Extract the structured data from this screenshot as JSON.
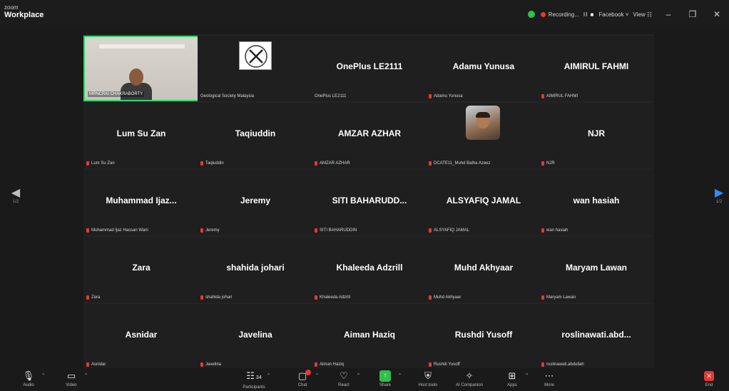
{
  "window": {
    "brand_top": "zoom",
    "brand_bottom": "Workplace",
    "recording": "Recording...",
    "recording_controls": "II ■",
    "live": "Facebook ˅",
    "view": "View ☷",
    "minimize": "–",
    "restore": "❐",
    "close": "✕"
  },
  "nav": {
    "prev": "◀",
    "next": "▶",
    "page_left": "1/2",
    "page_right": "1/2"
  },
  "tiles": [
    {
      "name": "",
      "label": "MRNCRAI CHAKRABORTY"
    },
    {
      "name": "",
      "label": "Geological Society Malaysia"
    },
    {
      "name": "OnePlus LE2111",
      "label": "OnePlus LE2111"
    },
    {
      "name": "Adamu Yunusa",
      "label": "Adamu Yunusa"
    },
    {
      "name": "AIMIRUL FAHMI",
      "label": "AIMIRUL FAHMI"
    },
    {
      "name": "Lum Su Zan",
      "label": "Lum Su Zan"
    },
    {
      "name": "Taqiuddin",
      "label": "Taqiuddin"
    },
    {
      "name": "AMZAR AZHAR",
      "label": "AMZAR AZHAR"
    },
    {
      "name": "",
      "label": "DCATE11_Muhd Balha Azeez"
    },
    {
      "name": "NJR",
      "label": "NJR"
    },
    {
      "name": "Muhammad Ijaz...",
      "label": "Muhammad Ijaz Hassan Wani"
    },
    {
      "name": "Jeremy",
      "label": "Jeremy"
    },
    {
      "name": "SITI BAHARUDD...",
      "label": "SITI BAHARUDDIN"
    },
    {
      "name": "ALSYAFIQ JAMAL",
      "label": "ALSYAFIQ JAMAL"
    },
    {
      "name": "wan hasiah",
      "label": "wan hasiah"
    },
    {
      "name": "Zara",
      "label": "Zara"
    },
    {
      "name": "shahida johari",
      "label": "shahida johari"
    },
    {
      "name": "Khaleeda Adzrill",
      "label": "Khaleeda Adzrill"
    },
    {
      "name": "Muhd Akhyaar",
      "label": "Muhd Akhyaar"
    },
    {
      "name": "Maryam Lawan",
      "label": "Maryam Lawan"
    },
    {
      "name": "Asnidar",
      "label": "Asnidar"
    },
    {
      "name": "Javelina",
      "label": "Javelina"
    },
    {
      "name": "Aiman Haziq",
      "label": "Aiman Haziq"
    },
    {
      "name": "Rushdi Yusoff",
      "label": "Rushdi Yusoff"
    },
    {
      "name": "roslinawati.abd...",
      "label": "roslinawati.abdullah"
    }
  ],
  "toolbar": {
    "audio": "Audio",
    "video": "Video",
    "participants": "Participants",
    "participants_count": "34",
    "chat": "Chat",
    "react": "React",
    "share": "Share",
    "host_tools": "Host tools",
    "ai_companion": "AI Companion",
    "apps": "Apps",
    "more": "More",
    "end": "End"
  },
  "colors": {
    "accent_green": "#2fd86d",
    "mute_red": "#e53935",
    "share_green": "#2fbf4a"
  }
}
